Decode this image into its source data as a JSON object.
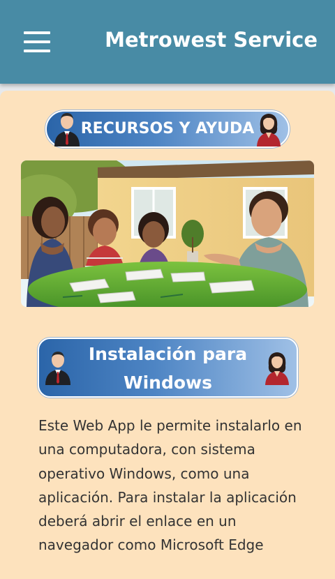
{
  "header": {
    "title": "Metrowest Service",
    "menu_icon": "hamburger-menu-icon",
    "background_color": "#488ba5"
  },
  "card": {
    "background_color": "#fde2bd"
  },
  "resources_banner": {
    "label": "RECURSOS Y AYUDA",
    "left_icon": "businessman-icon",
    "right_icon": "businesswoman-icon"
  },
  "hero_image": {
    "subject": "family-meeting-illustration"
  },
  "install_banner": {
    "label": "Instalación para Windows",
    "left_icon": "businessman-icon",
    "right_icon": "businesswoman-icon"
  },
  "body": {
    "paragraph": "Este Web App le permite instalarlo en una computadora, con sistema operativo Windows, como una aplicación. Para instalar la aplicación deberá abrir el enlace en un navegador como Microsoft Edge"
  }
}
